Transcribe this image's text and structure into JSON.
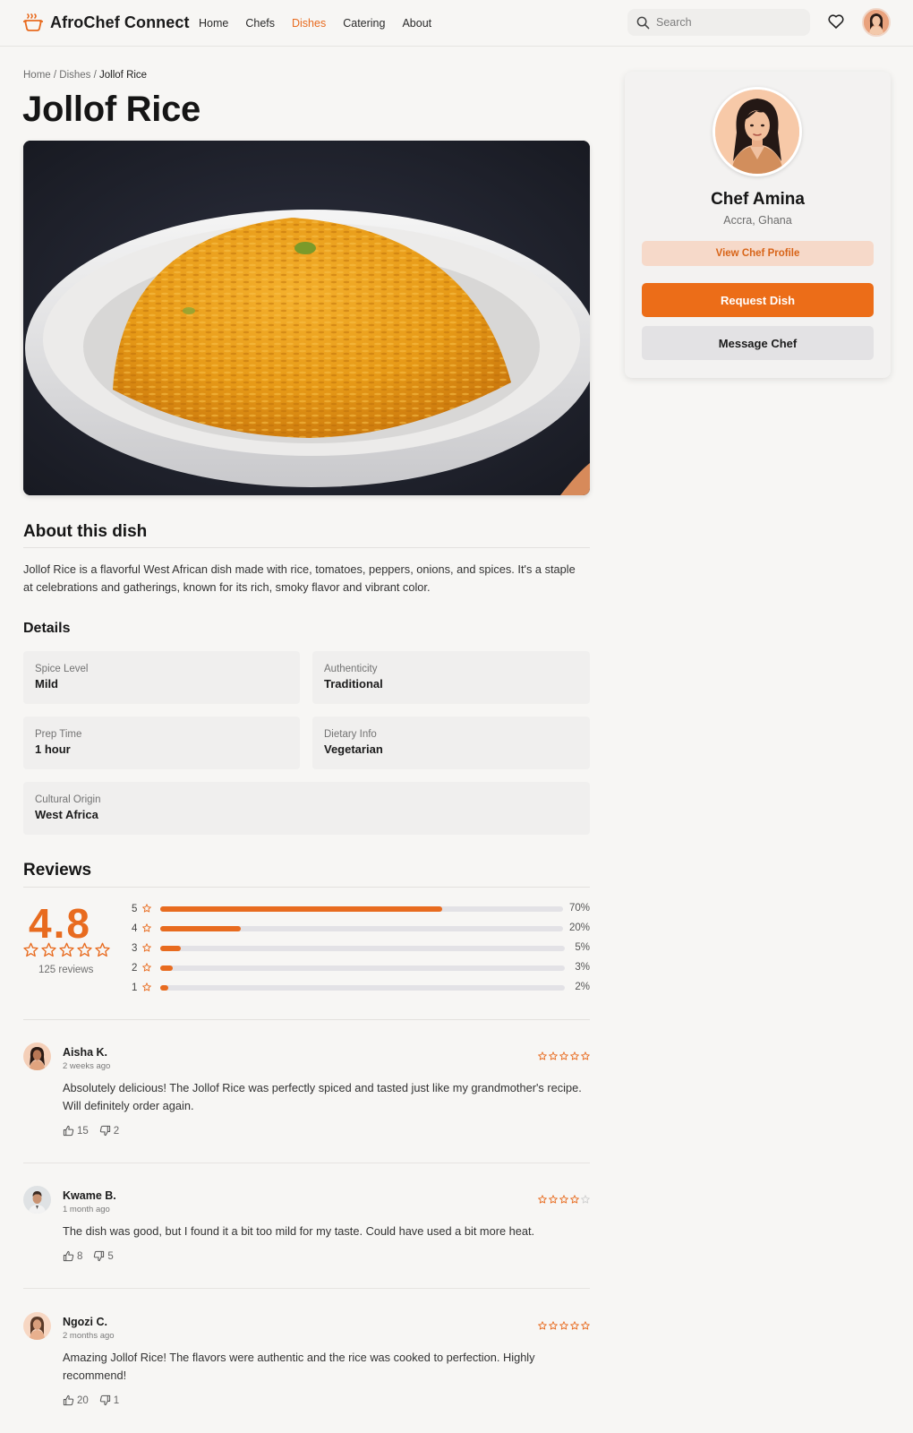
{
  "brand": {
    "name": "AfroChef Connect",
    "accent": "#e86b1f"
  },
  "nav": {
    "items": [
      "Home",
      "Chefs",
      "Dishes",
      "Catering",
      "About"
    ],
    "active": "Dishes"
  },
  "search": {
    "placeholder": "Search"
  },
  "breadcrumb": {
    "home": "Home",
    "sep": " / ",
    "section": "Dishes",
    "current": "Jollof Rice"
  },
  "dish": {
    "title": "Jollof Rice",
    "about_heading": "About this dish",
    "description": "Jollof Rice is a flavorful West African dish made with rice, tomatoes, peppers, onions, and spices. It's a staple at celebrations and gatherings, known for its rich, smoky flavor and vibrant color.",
    "details_heading": "Details",
    "details": [
      {
        "label": "Spice Level",
        "value": "Mild"
      },
      {
        "label": "Authenticity",
        "value": "Traditional"
      },
      {
        "label": "Prep Time",
        "value": "1 hour"
      },
      {
        "label": "Dietary Info",
        "value": "Vegetarian"
      },
      {
        "label": "Cultural Origin",
        "value": "West Africa"
      }
    ]
  },
  "ratings": {
    "heading": "Reviews",
    "average": "4.8",
    "stars": 5,
    "count_label": "125 reviews",
    "breakdown": [
      {
        "stars": "5",
        "pct": 70,
        "label": "70%"
      },
      {
        "stars": "4",
        "pct": 20,
        "label": "20%"
      },
      {
        "stars": "3",
        "pct": 5,
        "label": "5%"
      },
      {
        "stars": "2",
        "pct": 3,
        "label": "3%"
      },
      {
        "stars": "1",
        "pct": 2,
        "label": "2%"
      }
    ]
  },
  "reviews": [
    {
      "name": "Aisha K.",
      "time": "2 weeks ago",
      "rating": 5,
      "text": "Absolutely delicious! The Jollof Rice was perfectly spiced and tasted just like my grandmother's recipe. Will definitely order again.",
      "likes": "15",
      "dislikes": "2"
    },
    {
      "name": "Kwame B.",
      "time": "1 month ago",
      "rating": 4,
      "text": "The dish was good, but I found it a bit too mild for my taste. Could have used a bit more heat.",
      "likes": "8",
      "dislikes": "5"
    },
    {
      "name": "Ngozi C.",
      "time": "2 months ago",
      "rating": 5,
      "text": "Amazing Jollof Rice! The flavors were authentic and the rice was cooked to perfection. Highly recommend!",
      "likes": "20",
      "dislikes": "1"
    }
  ],
  "chef": {
    "name": "Chef Amina",
    "location": "Accra, Ghana",
    "view_profile": "View Chef Profile",
    "request": "Request Dish",
    "message": "Message Chef"
  }
}
